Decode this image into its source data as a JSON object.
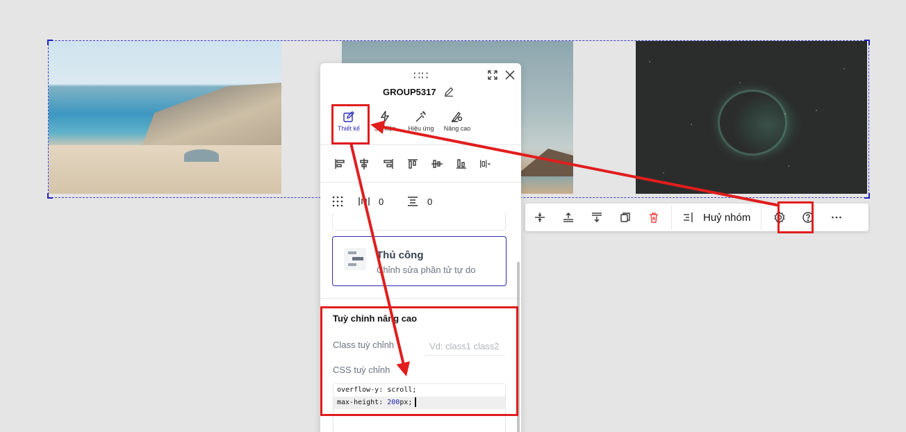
{
  "colors": {
    "accent": "#2b2bb5",
    "annotation": "#e11d1d",
    "danger": "#ef4444"
  },
  "images": [
    {
      "name": "beach-photo",
      "icon": "image"
    },
    {
      "name": "mountain-photo",
      "icon": "image"
    },
    {
      "name": "space-nebula-photo",
      "icon": "image"
    }
  ],
  "toolbar": {
    "items": [
      "align-vertical-center-icon",
      "align-top-icon",
      "align-bottom-icon",
      "duplicate-icon",
      "trash-icon",
      "ungroup-icon",
      "gear-icon",
      "help-icon",
      "more-icon"
    ],
    "ungroup_label": "Huỷ nhóm"
  },
  "panel": {
    "title": "GROUP5317",
    "tabs": [
      {
        "label": "Thiết kế",
        "icon": "pencil-icon",
        "active": true
      },
      {
        "label": "Sự kiện",
        "icon": "lightning-icon",
        "active": false
      },
      {
        "label": "Hiệu ứng",
        "icon": "magic-wand-icon",
        "active": false
      },
      {
        "label": "Nâng cao",
        "icon": "gear-pencil-icon",
        "active": false
      }
    ],
    "spacing": {
      "horizontal": "0",
      "vertical": "0"
    },
    "manual_option": {
      "title": "Thủ công",
      "description": "Chỉnh sửa phần tử tự do"
    },
    "advanced": {
      "title": "Tuỳ chỉnh nâng cao",
      "class_label": "Class tuỳ chỉnh",
      "class_placeholder": "Vd: class1 class2",
      "css_label": "CSS tuỳ chỉnh",
      "css_lines": {
        "line1": "overflow-y: scroll;",
        "line2_prop": "max-height: ",
        "line2_num": "200",
        "line2_unit": "px;"
      }
    }
  }
}
